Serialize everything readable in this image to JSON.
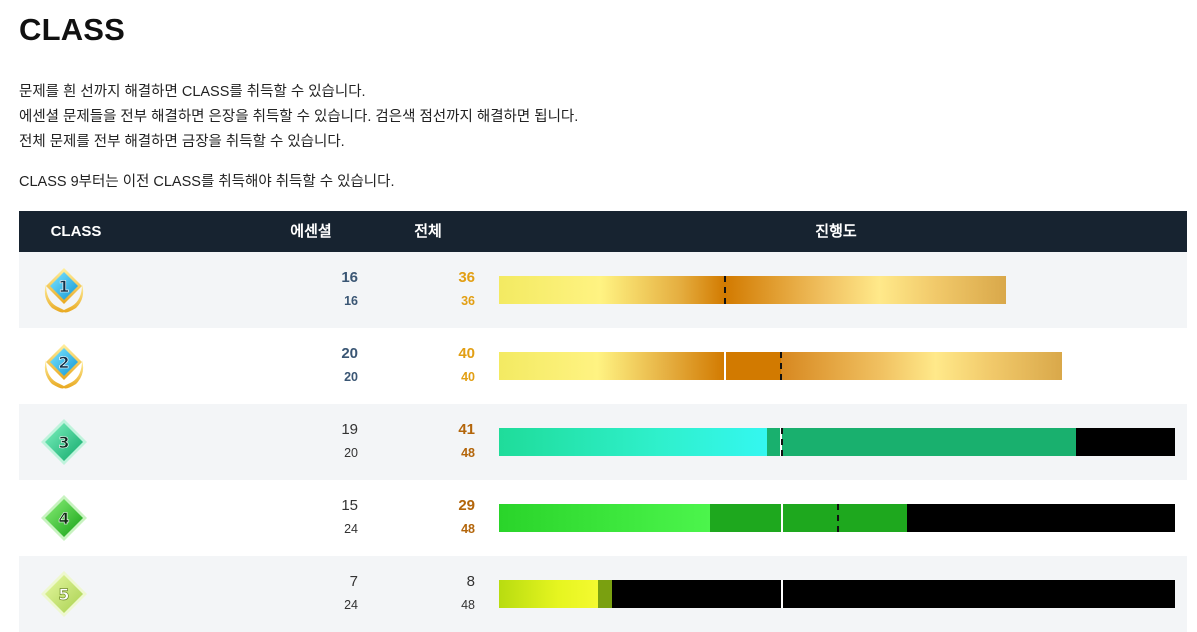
{
  "page": {
    "title": "CLASS",
    "description": [
      "문제를 흰 선까지 해결하면 CLASS를 취득할 수 있습니다.",
      "에센셜 문제들을 전부 해결하면 은장을 취득할 수 있습니다. 검은색 점선까지 해결하면 됩니다.",
      "전체 문제를 전부 해결하면 금장을 취득할 수 있습니다."
    ],
    "note": "CLASS 9부터는 이전 CLASS를 취득해야 취득할 수 있습니다."
  },
  "table": {
    "headers": {
      "class": "CLASS",
      "essential": "에센셜",
      "total": "전체",
      "progress": "진행도"
    },
    "rows": [
      {
        "class_label": "1",
        "badge": "gold-laurel-diamond-badge",
        "ess_solved": "16",
        "ess_total": "16",
        "total_solved": "36",
        "total_total": "36",
        "progress": 0.75
      },
      {
        "class_label": "2",
        "badge": "gold-laurel-diamond-badge",
        "ess_solved": "20",
        "ess_total": "20",
        "total_solved": "40",
        "total_total": "40",
        "progress": 0.833
      },
      {
        "class_label": "3",
        "badge": "green-diamond-badge",
        "ess_solved": "19",
        "ess_total": "20",
        "total_solved": "41",
        "total_total": "48",
        "progress": 0.854
      },
      {
        "class_label": "4",
        "badge": "green-diamond-badge",
        "ess_solved": "15",
        "ess_total": "24",
        "total_solved": "29",
        "total_total": "48",
        "progress": 0.604
      },
      {
        "class_label": "5",
        "badge": "light-green-diamond-badge",
        "ess_solved": "7",
        "ess_total": "24",
        "total_solved": "8",
        "total_total": "48",
        "progress": 0.167
      }
    ]
  },
  "colors": {
    "header_bg": "#172330",
    "essential_blue": "#3a5674",
    "total_gold": "#e29f14",
    "total_brown": "#b3650a",
    "bar_empty": "#000000",
    "class3_green": "#19b06e",
    "class4_green": "#1ea81e",
    "class5_olive": "#7aa010"
  }
}
